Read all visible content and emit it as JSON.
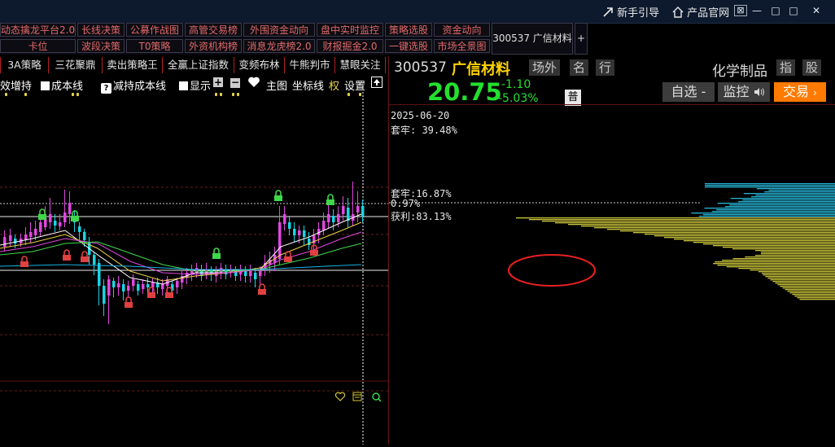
{
  "titlebar": {
    "guide": "新手引导",
    "website": "产品官网",
    "btn_restore": "⊠",
    "btn_min": "—",
    "btn_max": "□",
    "btn_close": "✕"
  },
  "modules": {
    "row1": [
      "动态擒龙平台2.0",
      "长线决策",
      "公募作战图",
      "高管交易榜",
      "外围资金动向",
      "盘中实时监控",
      "策略选股",
      "资金动向"
    ],
    "row2": [
      "卡位",
      "波段决策",
      "T0策略",
      "外资机构榜",
      "消息龙虎榜2.0",
      "财报掘金2.0",
      "一键选股",
      "市场全景图"
    ],
    "stock_button": "300537 广信材料",
    "plus": "+"
  },
  "strategies": [
    "3A策略",
    "三花聚鼎",
    "卖出策略王",
    "全赢上证指数",
    "变频布林",
    "牛熊判市",
    "慧眼关注"
  ],
  "toolbar": {
    "t1": "效增持",
    "t2": "成本线",
    "t3": "减持成本线",
    "t4": "显示",
    "main_chart": "主图",
    "axis": "坐标线",
    "fq": "权",
    "settings": "设置"
  },
  "stock": {
    "code": "300537",
    "name": "广信材料",
    "tags": [
      "场外",
      "名",
      "行"
    ],
    "industry": "化学制品",
    "index_tags": [
      "指",
      "股"
    ],
    "price": "20.75",
    "change": "-1.10",
    "change_pct": "-5.03%",
    "badge": "普",
    "btn_watch": "自选",
    "btn_watch_sep": "-",
    "btn_monitor": "监控",
    "btn_trade": "交易"
  },
  "profile": {
    "date": "2025-06-20",
    "trapped_label": "套牢: 39.48%",
    "trapped2": "套牢:16.87%",
    "mid": "0.97%",
    "profit": "获利:83.13%"
  },
  "colors": {
    "up": "#ff3b3b",
    "down": "#18d4e4",
    "trapped": "#27b6d8",
    "profit": "#cbc53a",
    "price_green": "#23e02f",
    "accent_trade": "#ff7a00",
    "module_text": "#e26a6a"
  },
  "icons": [
    "arrow-up-icon",
    "home-icon",
    "heart-icon",
    "lock-icon",
    "zoom-in-icon",
    "zoom-out-icon",
    "sound-icon",
    "question-icon"
  ]
}
